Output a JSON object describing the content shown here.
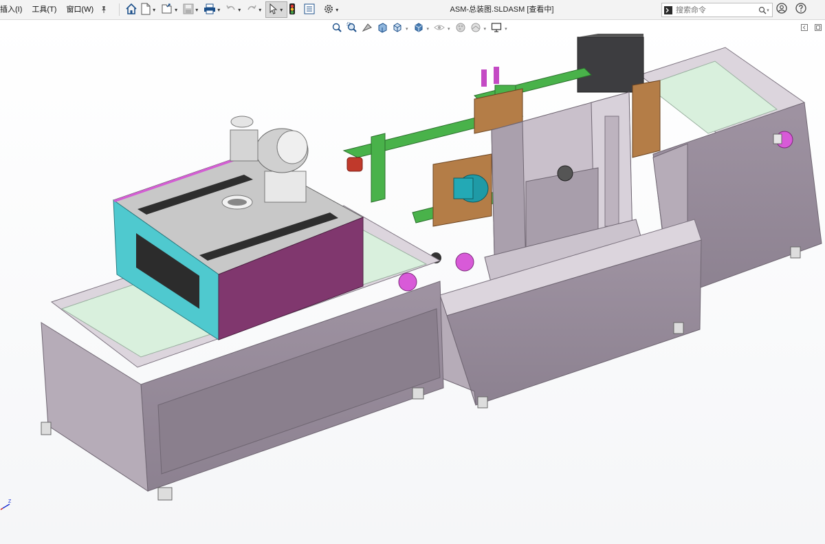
{
  "menu": [
    "插入(I)",
    "工具(T)",
    "窗口(W)"
  ],
  "document_title": "ASM-总装图.SLDASM [查看中]",
  "search": {
    "placeholder": "搜索命令"
  },
  "toolbar_icons": [
    "home-icon",
    "new-document-icon",
    "open-icon",
    "save-icon",
    "print-icon",
    "undo-icon",
    "redo-icon",
    "select-icon",
    "traffic-light-icon",
    "file-properties-icon",
    "options-icon"
  ],
  "heads_up_icons": [
    "zoom-to-fit-icon",
    "zoom-area-icon",
    "previous-view-icon",
    "section-view-icon",
    "view-orientation-icon",
    "display-style-icon",
    "hide-show-icon",
    "appearance-icon",
    "scene-icon",
    "display-settings-icon"
  ],
  "triad": {
    "z_label": "Z"
  },
  "colors": {
    "frame": "#a59aa8",
    "frame_light": "#cfc7d1",
    "cyan_panel": "#4fc9cf",
    "magenta_panel": "#80376e",
    "belt": "#d9f0dd",
    "green_frame": "#49b24a",
    "brown_part": "#b47d47",
    "pink_motor": "#d85ad8",
    "teal_motor": "#1f9aa6"
  }
}
